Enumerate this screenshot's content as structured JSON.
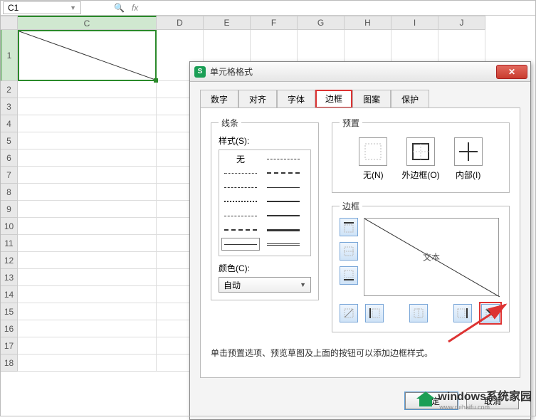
{
  "formula_bar": {
    "cell_ref": "C1",
    "fx": "fx"
  },
  "columns": [
    "C",
    "D",
    "E",
    "F",
    "G",
    "H",
    "I",
    "J"
  ],
  "rows": [
    "1",
    "2",
    "3",
    "4",
    "5",
    "6",
    "7",
    "8",
    "9",
    "10",
    "11",
    "12",
    "13",
    "14",
    "15",
    "16",
    "17",
    "18"
  ],
  "dialog": {
    "title": "单元格格式",
    "tabs": {
      "number": "数字",
      "align": "对齐",
      "font": "字体",
      "border": "边框",
      "pattern": "图案",
      "protect": "保护"
    },
    "line": {
      "legend": "线条",
      "style_label": "样式(S):",
      "none": "无",
      "color_label": "颜色(C):",
      "color_value": "自动"
    },
    "preset": {
      "legend": "预置",
      "none": "无(N)",
      "outer": "外边框(O)",
      "inner": "内部(I)"
    },
    "border": {
      "legend": "边框",
      "preview_text": "文本"
    },
    "hint": "单击预置选项、预览草图及上面的按钮可以添加边框样式。",
    "ok": "确定",
    "cancel": "取消"
  },
  "watermark": {
    "brand": "windows",
    "sub": "系统家园",
    "url": "www.ruihaifu.com"
  }
}
